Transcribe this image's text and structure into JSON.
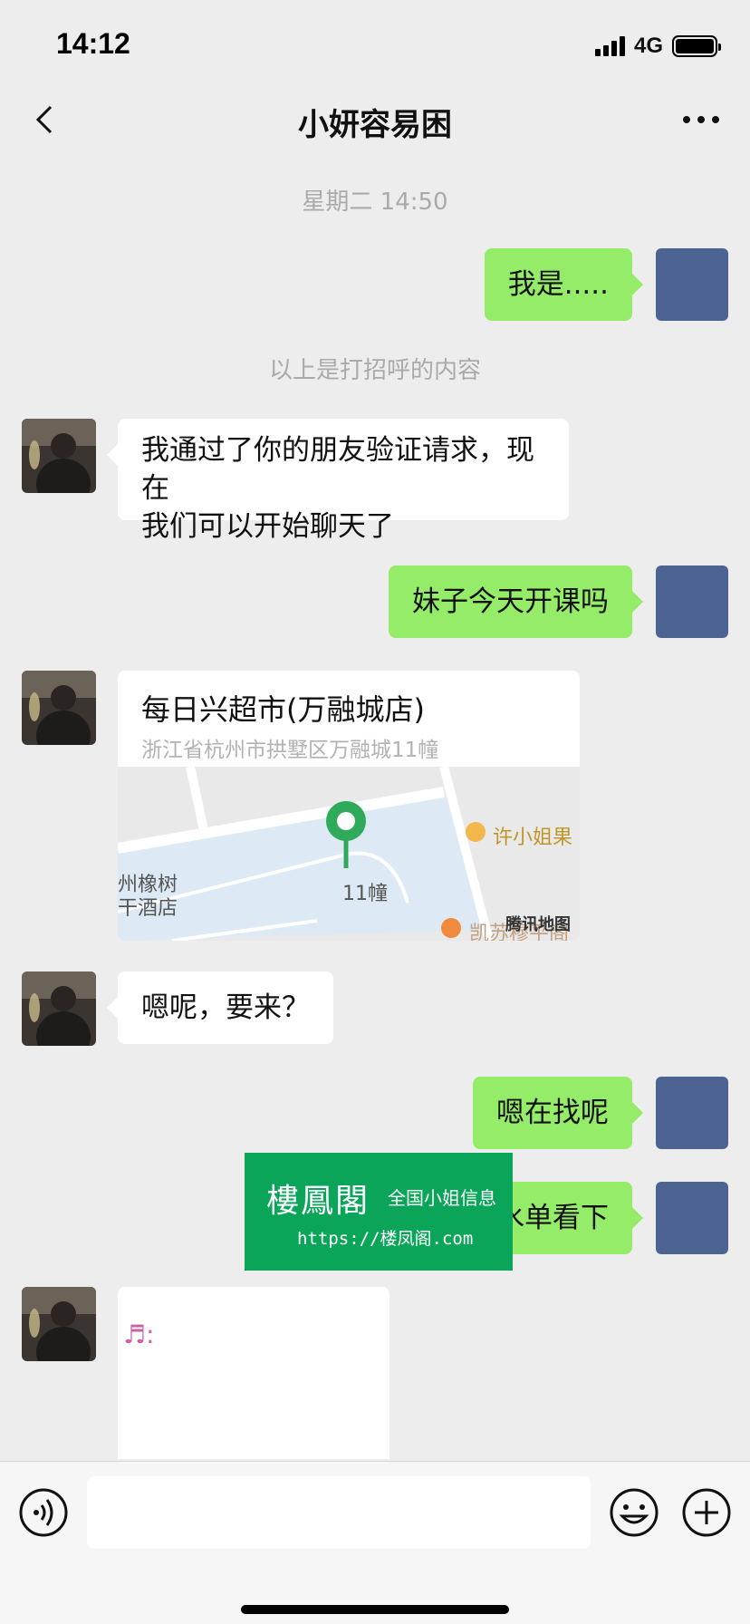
{
  "status_bar": {
    "time": "14:12",
    "network": "4G"
  },
  "nav": {
    "title": "小妍容易困"
  },
  "chat": {
    "timestamp": "星期二 14:50",
    "system_note": "以上是打招呼的内容",
    "messages": [
      {
        "from": "self",
        "text": "我是....."
      },
      {
        "from": "friend",
        "line1": "我通过了你的朋友验证请求，现在",
        "line2": "我们可以开始聊天了"
      },
      {
        "from": "self",
        "text": "妹子今天开课吗"
      },
      {
        "from": "friend",
        "type": "location",
        "name": "每日兴超市(万融城店)",
        "address": "浙江省杭州市拱墅区万融城11幢",
        "map": {
          "building": "11幢",
          "poi": "许小姐果",
          "left1": "州橡树",
          "left2": "干酒店",
          "provider": "腾讯地图",
          "bottom": "凯苏穆平阁"
        }
      },
      {
        "from": "friend",
        "text": "嗯呢，要来？"
      },
      {
        "from": "self",
        "text": "嗯在找呢"
      },
      {
        "from": "self",
        "text": "茶水单看下"
      },
      {
        "from": "friend",
        "type": "image",
        "caption": "♬:"
      }
    ]
  },
  "watermark": {
    "title": "樓鳳閣",
    "subtitle": "全国小姐信息",
    "url": "https://楼凤阁.com"
  },
  "input_bar": {
    "value": ""
  },
  "colors": {
    "self_bubble": "#95ec69",
    "self_avatar": "#4d6392",
    "background": "#ededed",
    "watermark_green": "#0aa559"
  }
}
